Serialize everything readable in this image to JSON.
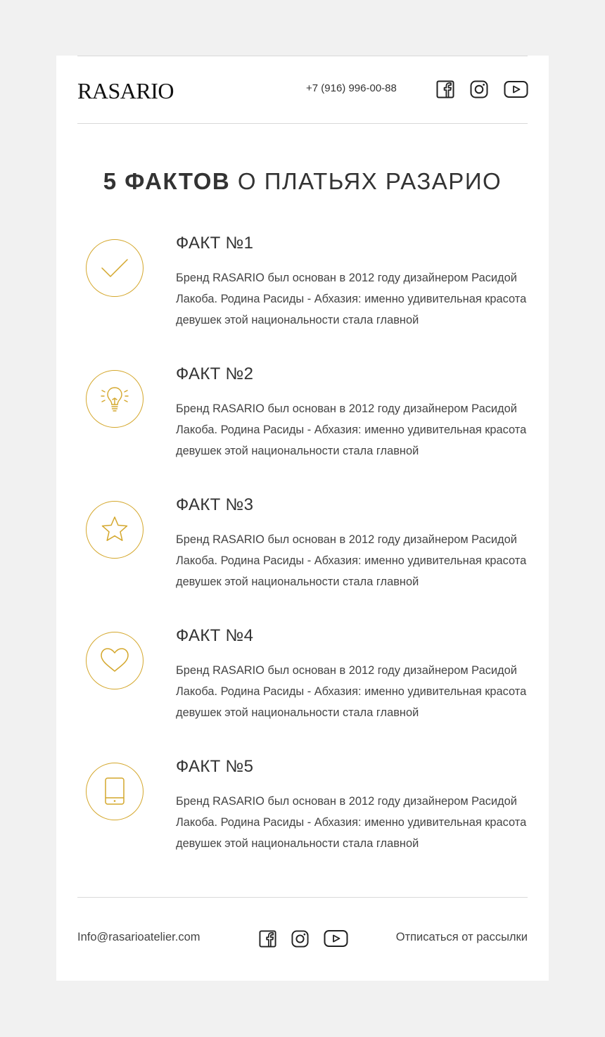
{
  "header": {
    "logo": "RASARIO",
    "phone": "+7 (916) 996-00-88",
    "social": [
      "facebook-icon",
      "instagram-icon",
      "youtube-icon"
    ]
  },
  "title": {
    "bold": "5 ФАКТОВ",
    "rest": " О ПЛАТЬЯХ РАЗАРИО"
  },
  "facts": [
    {
      "icon": "checkmark-icon",
      "title": "ФАКТ №1",
      "text": "Бренд RASARIO был основан в 2012 году дизайнером Расидой Лакоба. Родина Расиды - Абхазия: именно удивительная красота девушек этой национальности стала главной"
    },
    {
      "icon": "lightbulb-icon",
      "title": "ФАКТ №2",
      "text": "Бренд RASARIO был основан в 2012 году дизайнером Расидой Лакоба. Родина Расиды - Абхазия: именно удивительная красота девушек этой национальности стала главной"
    },
    {
      "icon": "star-icon",
      "title": "ФАКТ №3",
      "text": "Бренд RASARIO был основан в 2012 году дизайнером Расидой Лакоба. Родина Расиды - Абхазия: именно удивительная красота девушек этой национальности стала главной"
    },
    {
      "icon": "heart-icon",
      "title": "ФАКТ №4",
      "text": "Бренд RASARIO был основан в 2012 году дизайнером Расидой Лакоба. Родина Расиды - Абхазия: именно удивительная красота девушек этой национальности стала главной"
    },
    {
      "icon": "tablet-icon",
      "title": "ФАКТ №5",
      "text": "Бренд RASARIO был основан в 2012 году дизайнером Расидой Лакоба. Родина Расиды - Абхазия: именно удивительная красота девушек этой национальности стала главной"
    }
  ],
  "footer": {
    "email": "Info@rasarioatelier.com",
    "unsubscribe": "Отписаться от рассылки",
    "social": [
      "facebook-icon",
      "instagram-icon",
      "youtube-icon"
    ]
  },
  "colors": {
    "accent": "#d4a72c",
    "background": "#f1f1f1",
    "card": "#ffffff",
    "text": "#333333",
    "divider": "#d9d9d9"
  }
}
